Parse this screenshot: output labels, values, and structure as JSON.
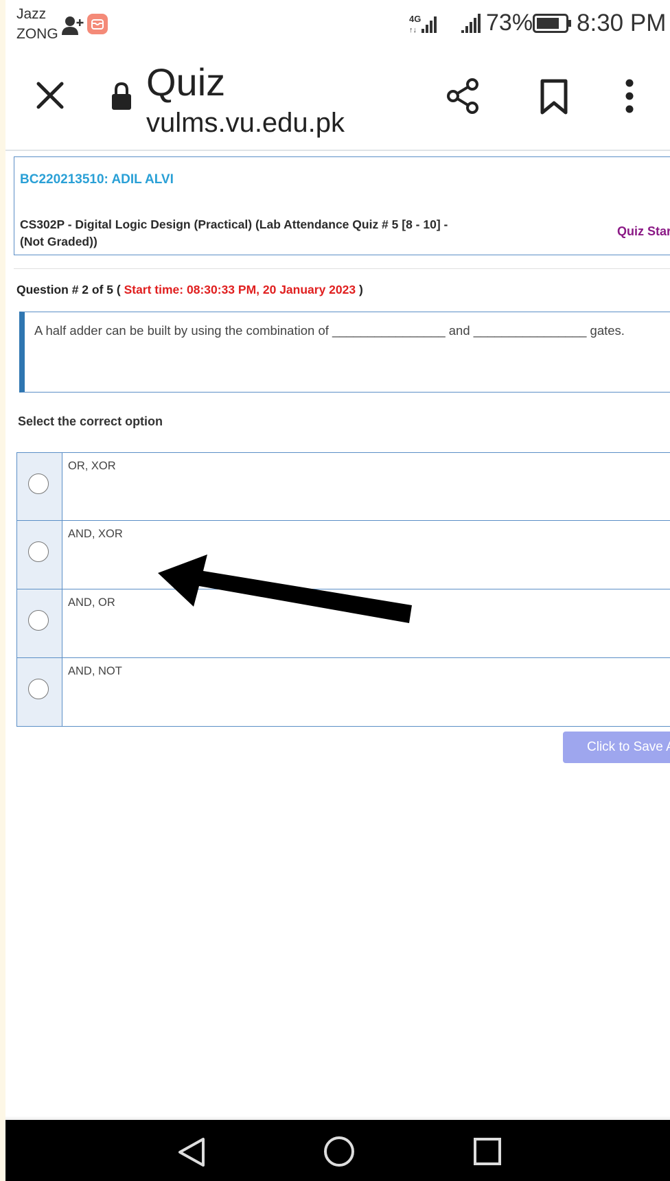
{
  "status_bar": {
    "carrier_1": "Jazz",
    "carrier_2": "ZONG",
    "battery": "73%",
    "time": "8:30 PM",
    "icons": [
      "add-user-icon",
      "app-notification-icon",
      "signal-4g-icon",
      "signal-icon",
      "battery-icon"
    ]
  },
  "browser": {
    "title": "Quiz",
    "url": "vulms.vu.edu.pk",
    "icons": [
      "close-icon",
      "lock-icon",
      "share-icon",
      "bookmark-icon",
      "more-vert-icon"
    ]
  },
  "student": {
    "id_name": "BC220213510: ADIL ALVI",
    "course": "CS302P - Digital Logic Design (Practical) (Lab Attendance Quiz # 5 [8 - 10] - (Not Graded))",
    "quiz_start": "Quiz Start"
  },
  "question": {
    "prefix": "Question # 2 of 5 (",
    "start_time": "Start time: 08:30:33 PM, 20 January 2023",
    "suffix": ")",
    "text": "A half adder can be built by using the combination of ________________ and ________________ gates."
  },
  "select_label": "Select the correct option",
  "options": [
    {
      "label": "OR, XOR",
      "selected": false
    },
    {
      "label": "AND, XOR",
      "selected": false
    },
    {
      "label": "AND, OR",
      "selected": false
    },
    {
      "label": "AND, NOT",
      "selected": false
    }
  ],
  "save_button": "Click to Save Answer",
  "annotation": {
    "type": "arrow",
    "points_to": "AND, XOR",
    "color": "#000000"
  },
  "colors": {
    "accent_blue": "#2aa0d6",
    "start_time_red": "#e01f1f",
    "quiz_start_purple": "#8b1a86",
    "border_blue": "#5a8ec6",
    "save_button": "#9ea6ee"
  }
}
